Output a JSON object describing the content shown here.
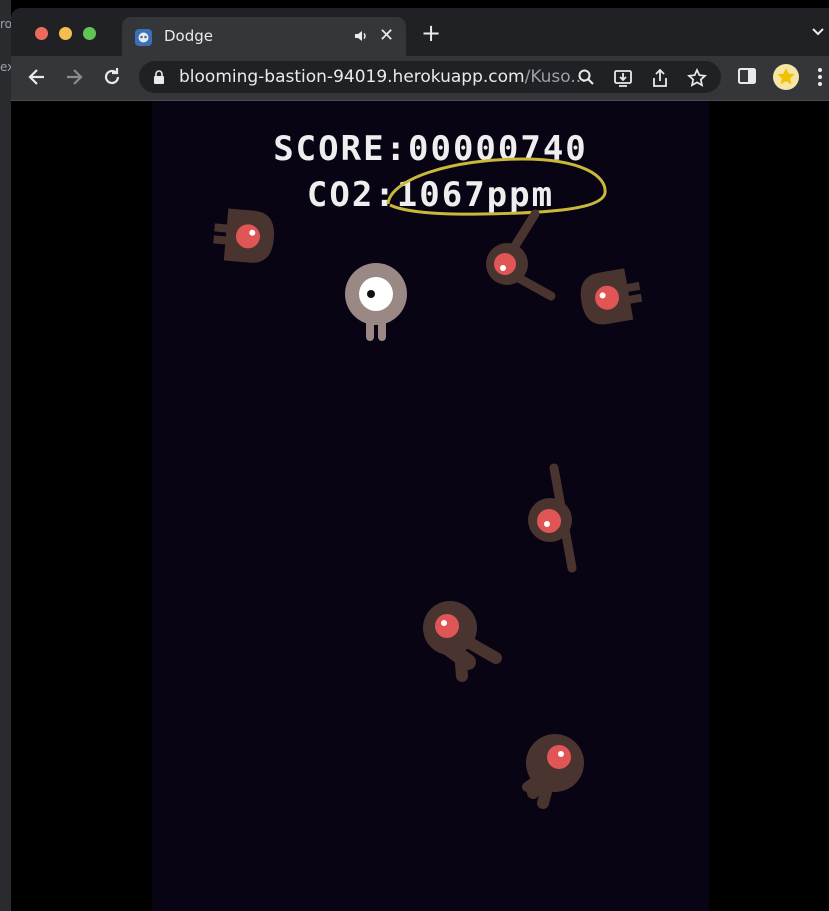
{
  "edge": {
    "top_text": "ro",
    "bottom_text": "ex"
  },
  "browser": {
    "tab": {
      "title": "Dodge",
      "favicon": "godot-icon",
      "audio_icon": "speaker-icon"
    },
    "new_tab_icon": "plus-icon",
    "url_host": "blooming-bastion-94019.herokuapp.com",
    "url_path": "/Kuso...",
    "toolbar_icons": [
      "back-icon",
      "forward-icon",
      "reload-icon",
      "lock-icon",
      "search-icon",
      "install-icon",
      "share-icon",
      "star-icon",
      "sidepanel-icon",
      "profile-icon",
      "menu-icon"
    ]
  },
  "game": {
    "score_text": "SCORE:00000740",
    "co2_text": "CO2:1067ppm",
    "colors": {
      "background": "#080414",
      "enemy": "#4a3430",
      "enemy_eye": "#e05555",
      "player": "#9a8884",
      "player_eye": "#ffffff",
      "annotation": "#c9b83a"
    },
    "player": {
      "name": "player-ghost"
    },
    "enemies": [
      "enemy-mob",
      "enemy-mob",
      "enemy-mob",
      "enemy-mob",
      "enemy-mob",
      "enemy-mob",
      "enemy-mob"
    ]
  }
}
